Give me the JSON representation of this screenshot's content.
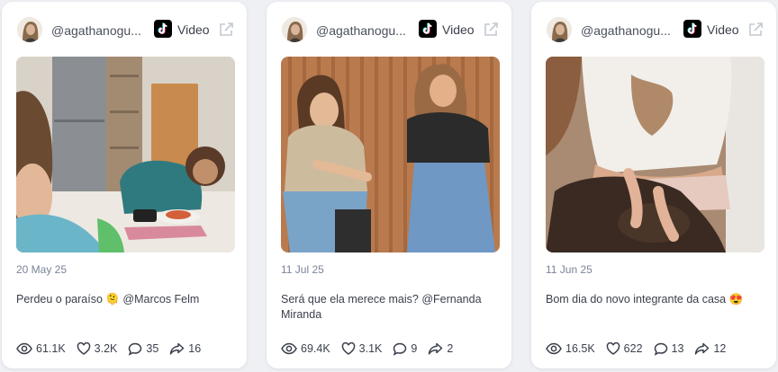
{
  "posts": [
    {
      "handle": "@agathanogu...",
      "type_label": "Video",
      "date": "20 May 25",
      "caption": "Perdeu o paraíso 🫠 @Marcos Felm",
      "stats": {
        "views": "61.1K",
        "likes": "3.2K",
        "comments": "35",
        "shares": "16"
      }
    },
    {
      "handle": "@agathanogu...",
      "type_label": "Video",
      "date": "11 Jul 25",
      "caption": "Será que ela merece mais? @Fernanda Miranda",
      "stats": {
        "views": "69.4K",
        "likes": "3.1K",
        "comments": "9",
        "shares": "2"
      }
    },
    {
      "handle": "@agathanogu...",
      "type_label": "Video",
      "date": "11 Jun 25",
      "caption": "Bom dia do novo integrante da casa 😍",
      "stats": {
        "views": "16.5K",
        "likes": "622",
        "comments": "13",
        "shares": "12"
      }
    }
  ],
  "icons": {
    "platform": "tiktok-icon",
    "external": "external-link-icon",
    "views": "eye-icon",
    "likes": "heart-icon",
    "comments": "comment-icon",
    "shares": "share-icon"
  },
  "colors": {
    "background": "#eef0f4",
    "card": "#ffffff",
    "muted_text": "#7a8396"
  }
}
